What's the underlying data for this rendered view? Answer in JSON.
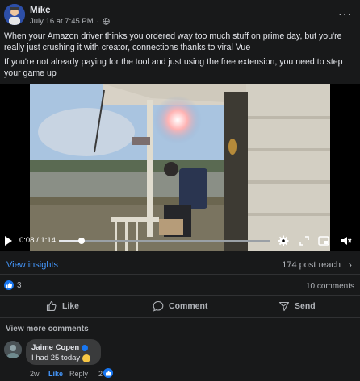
{
  "post": {
    "author": "Mike",
    "timestamp": "July 16 at 7:45 PM",
    "separator": "·",
    "privacy_icon": "globe-icon",
    "more_icon": "more-horizontal-icon",
    "paragraph_1": "When your Amazon driver thinks you ordered way too much stuff on prime day, but you're really just crushing it with creator, connections thanks to viral Vue",
    "paragraph_2": "If you're not already paying for the tool and just using the free extension, you need to step your game up"
  },
  "video": {
    "time": "0:08 / 1:14",
    "progress_fraction": 0.108,
    "icons": [
      "play-icon",
      "settings-icon",
      "fullscreen-icon",
      "pip-icon",
      "mute-icon"
    ]
  },
  "insights": {
    "label": "View insights",
    "reach": "174 post reach",
    "chevron_icon": "chevron-right-icon"
  },
  "engagement": {
    "reaction_icon": "thumbs-up-reaction-icon",
    "reaction_count": "3",
    "comments": "10 comments"
  },
  "actions": {
    "like": "Like",
    "comment": "Comment",
    "send": "Send"
  },
  "comments_section": {
    "view_more": "View more comments",
    "comment": {
      "name": "Jaime Copen",
      "text": "I had 25 today",
      "age": "2w",
      "like": "Like",
      "reply": "Reply",
      "reaction_count": "2"
    }
  },
  "colors": {
    "background": "#18191a",
    "accent": "#1877f2",
    "link": "#4599ff",
    "muted": "#b0b3b8"
  }
}
